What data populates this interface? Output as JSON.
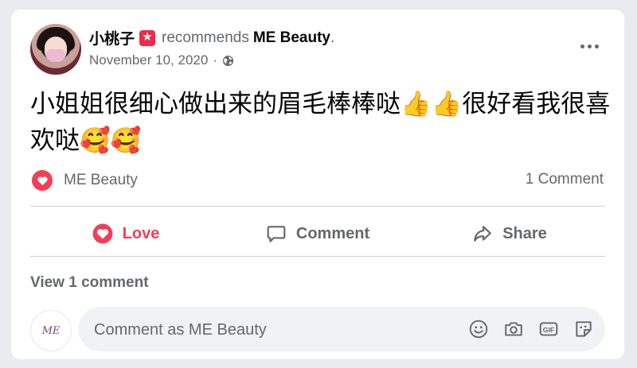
{
  "post": {
    "author": "小桃子",
    "recommends_text": "recommends",
    "page_name": "ME Beauty",
    "page_name_suffix": ".",
    "date": "November 10, 2020",
    "date_separator": "·",
    "text": "小姐姐很细心做出来的眉毛棒棒哒👍👍很好看我很喜欢哒🥰🥰"
  },
  "reactions": {
    "icon": "love-reaction",
    "reactor": "ME Beauty",
    "comment_count": "1 Comment"
  },
  "actions": {
    "love_label": "Love",
    "comment_label": "Comment",
    "share_label": "Share"
  },
  "comments": {
    "view_label": "View 1 comment"
  },
  "composer": {
    "avatar_text": "ME",
    "placeholder": "Comment as ME Beauty",
    "icons": [
      "emoji-icon",
      "camera-icon",
      "gif-icon",
      "sticker-icon"
    ]
  },
  "colors": {
    "love": "#f33e58",
    "badge": "#f02849",
    "secondary_text": "#65676b",
    "background": "#e9ebee"
  }
}
